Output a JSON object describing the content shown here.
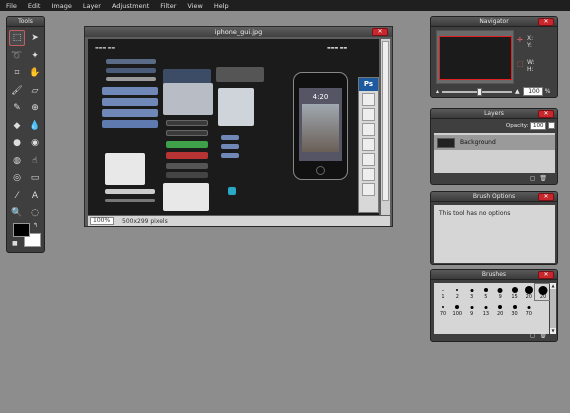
{
  "menu": [
    "File",
    "Edit",
    "Image",
    "Layer",
    "Adjustment",
    "Filter",
    "View",
    "Help"
  ],
  "tools": {
    "title": "Tools",
    "items": [
      {
        "name": "marquee-select",
        "glyph": "⬚"
      },
      {
        "name": "move",
        "glyph": "➤"
      },
      {
        "name": "lasso",
        "glyph": "➰"
      },
      {
        "name": "magic-wand",
        "glyph": "✦"
      },
      {
        "name": "crop",
        "glyph": "⌗"
      },
      {
        "name": "hand",
        "glyph": "✋"
      },
      {
        "name": "brush",
        "glyph": "🖌"
      },
      {
        "name": "eraser",
        "glyph": "▱"
      },
      {
        "name": "pencil",
        "glyph": "✎"
      },
      {
        "name": "clone-stamp",
        "glyph": "⊕"
      },
      {
        "name": "paint-bucket",
        "glyph": "◆"
      },
      {
        "name": "blur",
        "glyph": "💧"
      },
      {
        "name": "dodge",
        "glyph": "●"
      },
      {
        "name": "burn",
        "glyph": "◉"
      },
      {
        "name": "sponge",
        "glyph": "◍"
      },
      {
        "name": "smudge",
        "glyph": "☝"
      },
      {
        "name": "red-eye",
        "glyph": "◎"
      },
      {
        "name": "shape",
        "glyph": "▭"
      },
      {
        "name": "eye-dropper",
        "glyph": "⁄"
      },
      {
        "name": "text",
        "glyph": "A"
      },
      {
        "name": "zoom",
        "glyph": "🔍"
      },
      {
        "name": "bloat",
        "glyph": "◌"
      }
    ],
    "fg_color": "#000000",
    "bg_color": "#ffffff"
  },
  "image_window": {
    "title": "iphone_gui.jpg",
    "zoom": "100%",
    "dimensions": "500x299 pixels",
    "content": {
      "time": "4:20",
      "ps_label": "Ps"
    }
  },
  "navigator": {
    "title": "Navigator",
    "x_label": "X:",
    "y_label": "Y:",
    "w_label": "W:",
    "h_label": "H:",
    "zoom_value": "100",
    "zoom_unit": "%"
  },
  "layers": {
    "title": "Layers",
    "opacity_label": "Opacity:",
    "opacity_value": "100",
    "layer_name": "Background"
  },
  "brush_options": {
    "title": "Brush Options",
    "message": "This tool has no options"
  },
  "brushes": {
    "title": "Brushes",
    "items": [
      {
        "label": "1",
        "size": 1
      },
      {
        "label": "2",
        "size": 2
      },
      {
        "label": "3",
        "size": 3
      },
      {
        "label": "5",
        "size": 4
      },
      {
        "label": "9",
        "size": 5
      },
      {
        "label": "15",
        "size": 6
      },
      {
        "label": "20",
        "size": 8
      },
      {
        "label": "20",
        "size": 9
      },
      {
        "label": "70",
        "size": 2
      },
      {
        "label": "100",
        "size": 4
      },
      {
        "label": "9",
        "size": 3
      },
      {
        "label": "13",
        "size": 3
      },
      {
        "label": "20",
        "size": 4
      },
      {
        "label": "30",
        "size": 4
      },
      {
        "label": "70",
        "size": 3
      }
    ]
  }
}
